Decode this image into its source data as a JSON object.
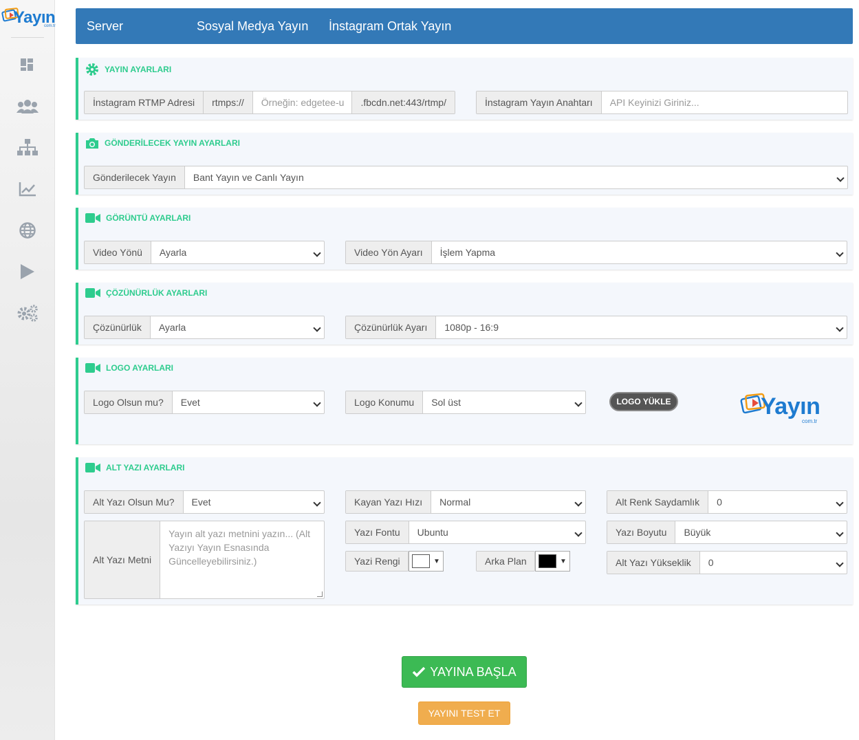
{
  "brand": {
    "name": "Yayın",
    "suffix": "com.tr"
  },
  "sidebar": {
    "icons": [
      "dashboard-icon",
      "users-icon",
      "sitemap-icon",
      "chart-icon",
      "globe-icon",
      "play-icon",
      "cogs-icon"
    ]
  },
  "topnav": {
    "tabs": [
      "Server",
      "Sosyal Medya Yayın",
      "İnstagram Ortak Yayın"
    ]
  },
  "yayin_ayarlari": {
    "title": "YAYIN AYARLARI",
    "rtmp_label": "İnstagram RTMP Adresi",
    "rtmp_prefix": "rtmps://",
    "rtmp_placeholder": "Örneğin: edgetee-u",
    "rtmp_suffix": ".fbcdn.net:443/rtmp/",
    "key_label": "İnstagram Yayın Anahtarı",
    "key_placeholder": "API Keyinizi Giriniz..."
  },
  "gonderilecek": {
    "title": "GÖNDERİLECEK YAYIN AYARLARI",
    "label": "Gönderilecek Yayın",
    "value": "Bant Yayın ve Canlı Yayın"
  },
  "goruntu": {
    "title": "GÖRÜNTÜ AYARLARI",
    "yon_label": "Video Yönü",
    "yon_value": "Ayarla",
    "yon_ayar_label": "Video Yön Ayarı",
    "yon_ayar_value": "İşlem Yapma"
  },
  "cozunurluk": {
    "title": "ÇÖZÜNÜRLÜK AYARLARI",
    "label": "Çözünürlük",
    "value": "Ayarla",
    "ayar_label": "Çözünürlük Ayarı",
    "ayar_value": "1080p - 16:9"
  },
  "logo": {
    "title": "LOGO AYARLARI",
    "olsun_label": "Logo Olsun mu?",
    "olsun_value": "Evet",
    "konum_label": "Logo Konumu",
    "konum_value": "Sol üst",
    "upload_label": "LOGO YÜKLE"
  },
  "altyazi": {
    "title": "ALT YAZI AYARLARI",
    "olsun_label": "Alt Yazı Olsun Mu?",
    "olsun_value": "Evet",
    "metin_label": "Alt Yazı Metni",
    "metin_placeholder": "Yayın alt yazı metnini yazın... (Alt Yazıyı Yayın Esnasında Güncelleyebilirsiniz.)",
    "hiz_label": "Kayan Yazı Hızı",
    "hiz_value": "Normal",
    "font_label": "Yazı Fontu",
    "font_value": "Ubuntu",
    "renk_label": "Yazi Rengi",
    "renk_color": "#ffffff",
    "arka_label": "Arka Plan",
    "arka_color": "#000000",
    "saydamlik_label": "Alt Renk Saydamlık",
    "saydamlik_value": "0",
    "boyut_label": "Yazı Boyutu",
    "boyut_value": "Büyük",
    "yukseklik_label": "Alt Yazı Yükseklik",
    "yukseklik_value": "0"
  },
  "actions": {
    "start_label": "YAYINA BAŞLA",
    "test_label": "YAYINI TEST ET"
  },
  "colors": {
    "accent": "#2ecc8e",
    "topbar": "#3379b7",
    "start": "#3cba54",
    "test": "#f0ad4e",
    "brand": "#1e7bd0"
  }
}
